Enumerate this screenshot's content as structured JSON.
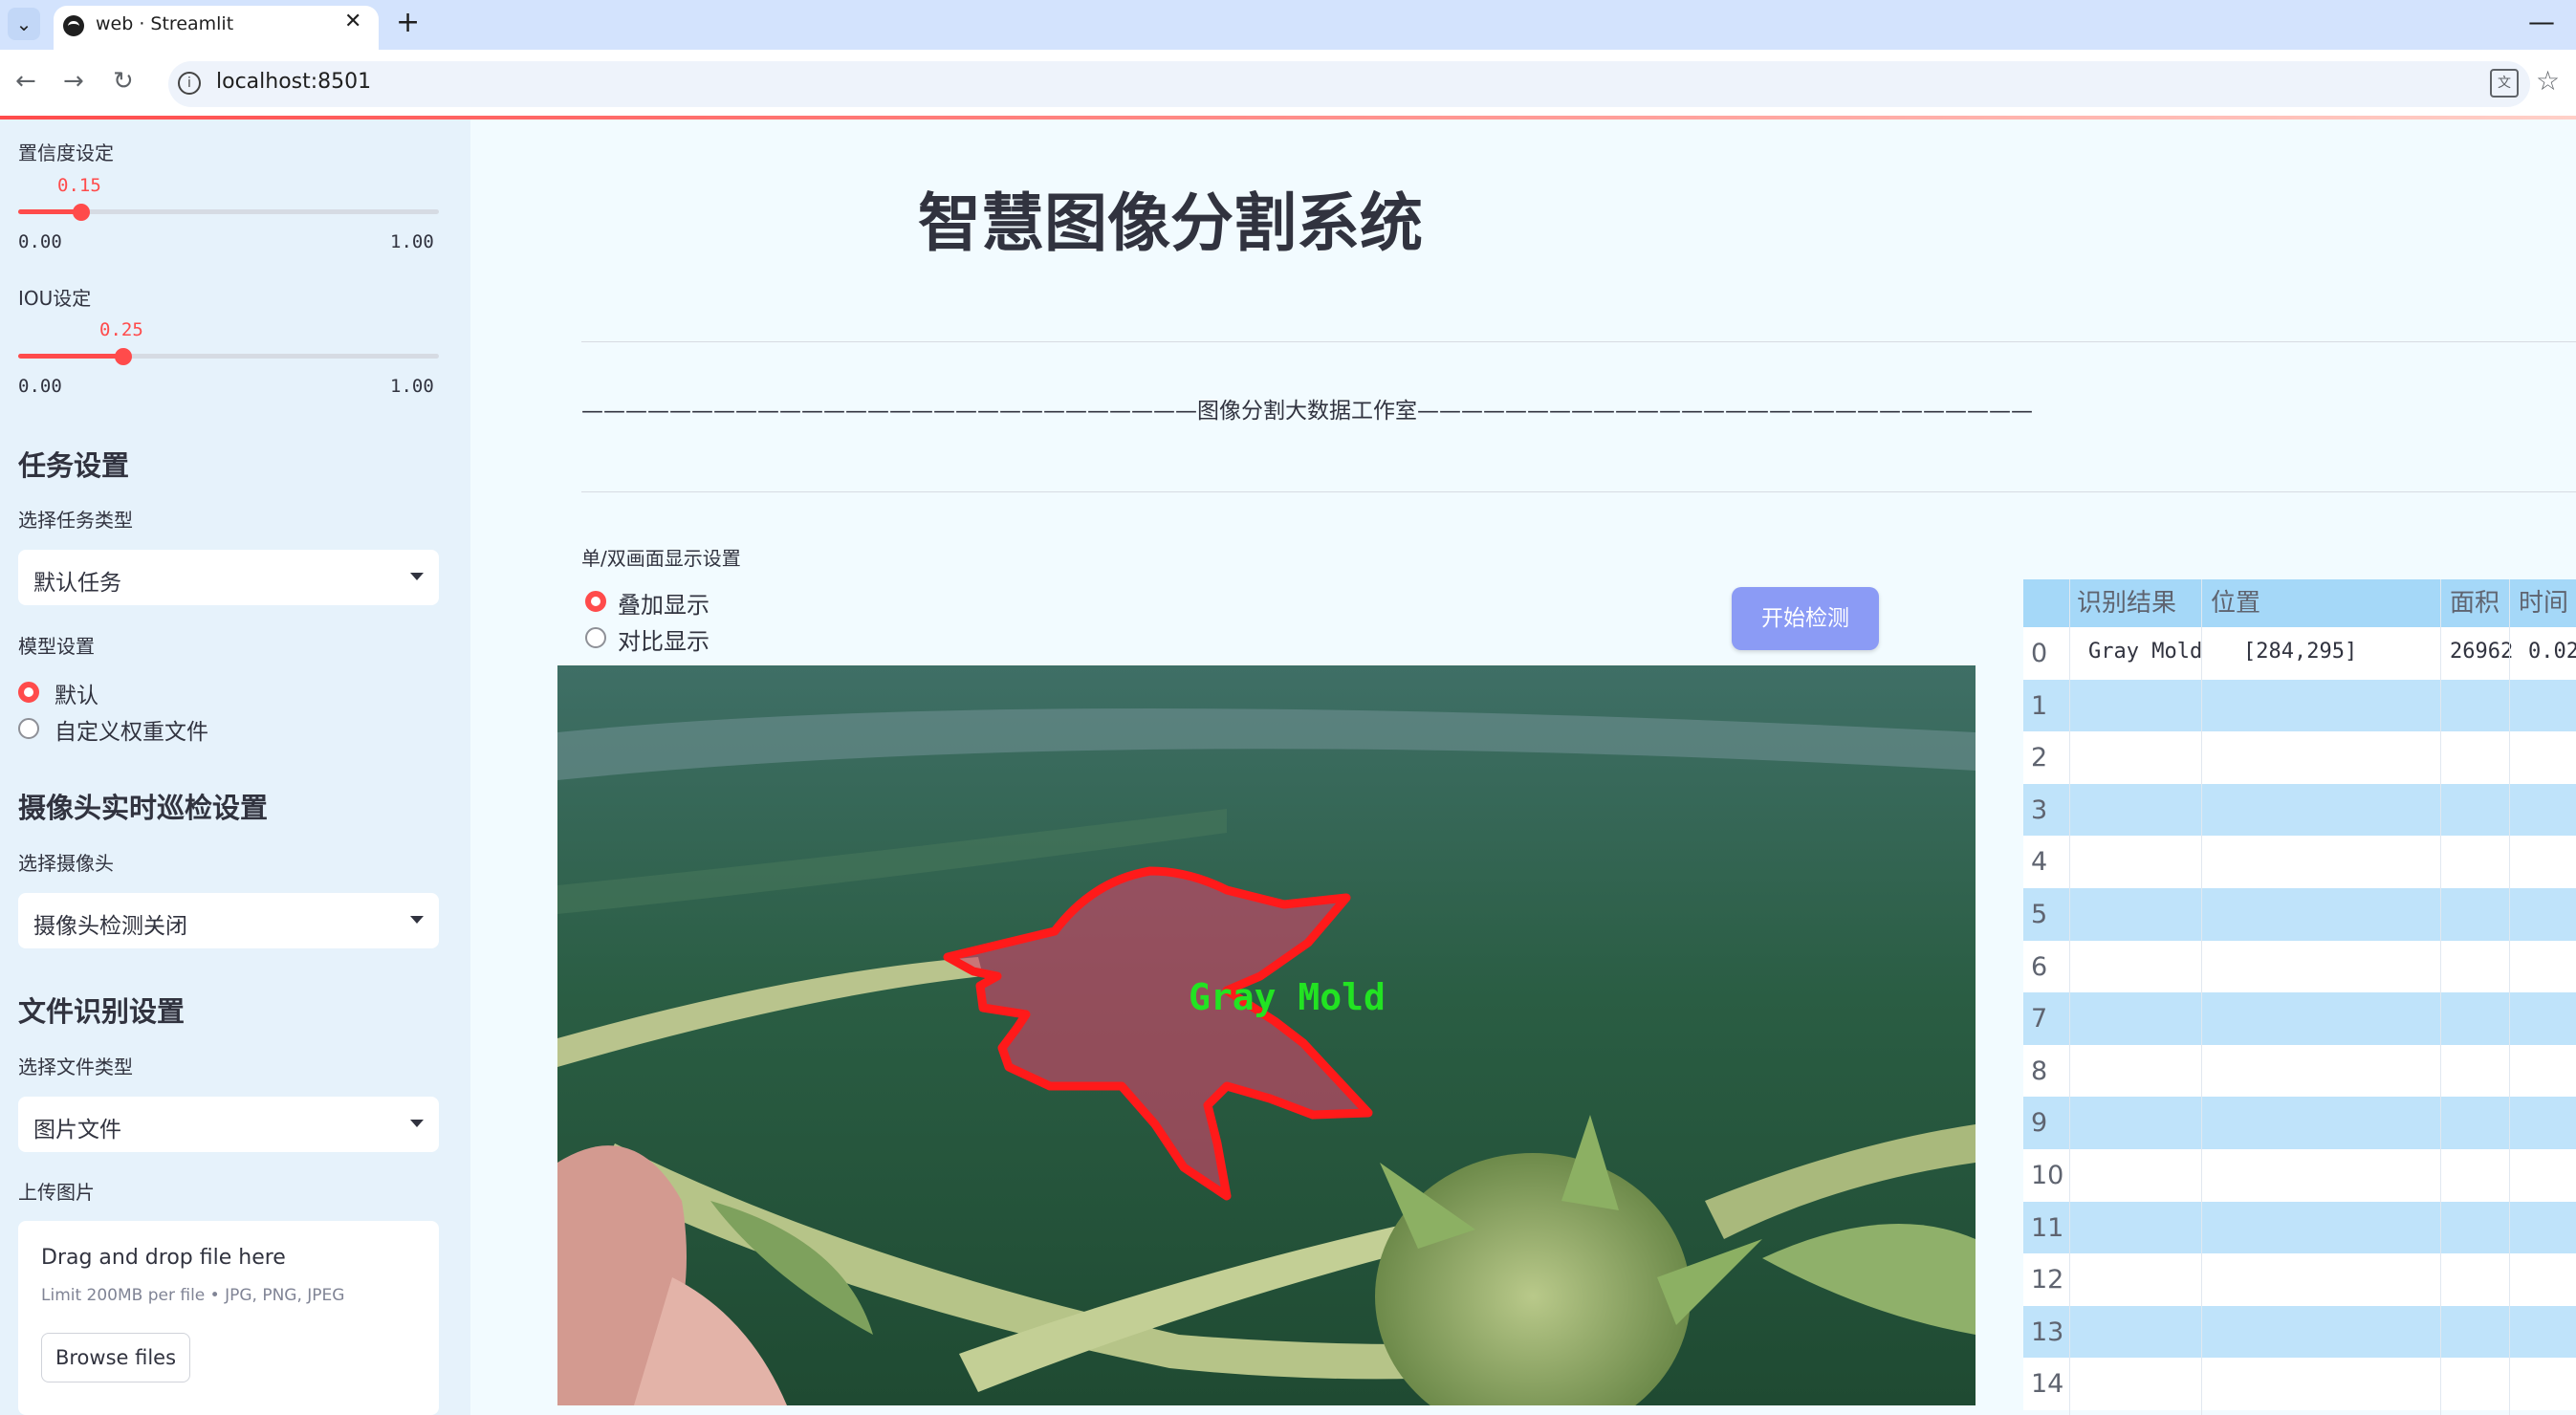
{
  "browser": {
    "tab_title": "web · Streamlit",
    "url": "localhost:8501",
    "icons": [
      "tab-list-icon",
      "close-icon",
      "plus-icon",
      "minimize-icon",
      "back-icon",
      "forward-icon",
      "reload-icon",
      "info-icon",
      "translate-icon",
      "star-icon"
    ]
  },
  "sidebar": {
    "confidence": {
      "label": "置信度设定",
      "value": "0.15",
      "min": "0.00",
      "max": "1.00",
      "fraction": 0.15
    },
    "iou": {
      "label": "IOU设定",
      "value": "0.25",
      "min": "0.00",
      "max": "1.00",
      "fraction": 0.25
    },
    "task": {
      "heading": "任务设置",
      "select_label": "选择任务类型",
      "selected": "默认任务"
    },
    "model": {
      "label": "模型设置",
      "options": [
        "默认",
        "自定义权重文件"
      ],
      "selected_index": 0
    },
    "camera": {
      "heading": "摄像头实时巡检设置",
      "select_label": "选择摄像头",
      "selected": "摄像头检测关闭"
    },
    "file": {
      "heading": "文件识别设置",
      "select_label": "选择文件类型",
      "selected": "图片文件"
    },
    "upload": {
      "label": "上传图片",
      "drop_text": "Drag and drop file here",
      "limit_text": "Limit 200MB per file • JPG, PNG, JPEG",
      "browse_label": "Browse files"
    }
  },
  "main": {
    "title": "智慧图像分割系统",
    "studio_line": "————————————————————————————图像分割大数据工作室————————————————————————————",
    "display": {
      "label": "单/双画面显示设置",
      "options": [
        "叠加显示",
        "对比显示"
      ],
      "selected_index": 0
    },
    "start_button": "开始检测",
    "detection_label": "Gray Mold",
    "colors": {
      "accent": "#ff4b4b",
      "button": "#8b9bf5",
      "mask_outline": "#ff1a1a",
      "label_text": "#22e322"
    }
  },
  "table": {
    "columns": [
      "识别结果",
      "位置",
      "面积",
      "时间"
    ],
    "row_indices": [
      "0",
      "1",
      "2",
      "3",
      "4",
      "5",
      "6",
      "7",
      "8",
      "9",
      "10",
      "11",
      "12",
      "13",
      "14"
    ],
    "rows": [
      {
        "result": "Gray Mold",
        "position": "[284,295]",
        "area": "26962",
        "time": "0.02"
      }
    ]
  }
}
